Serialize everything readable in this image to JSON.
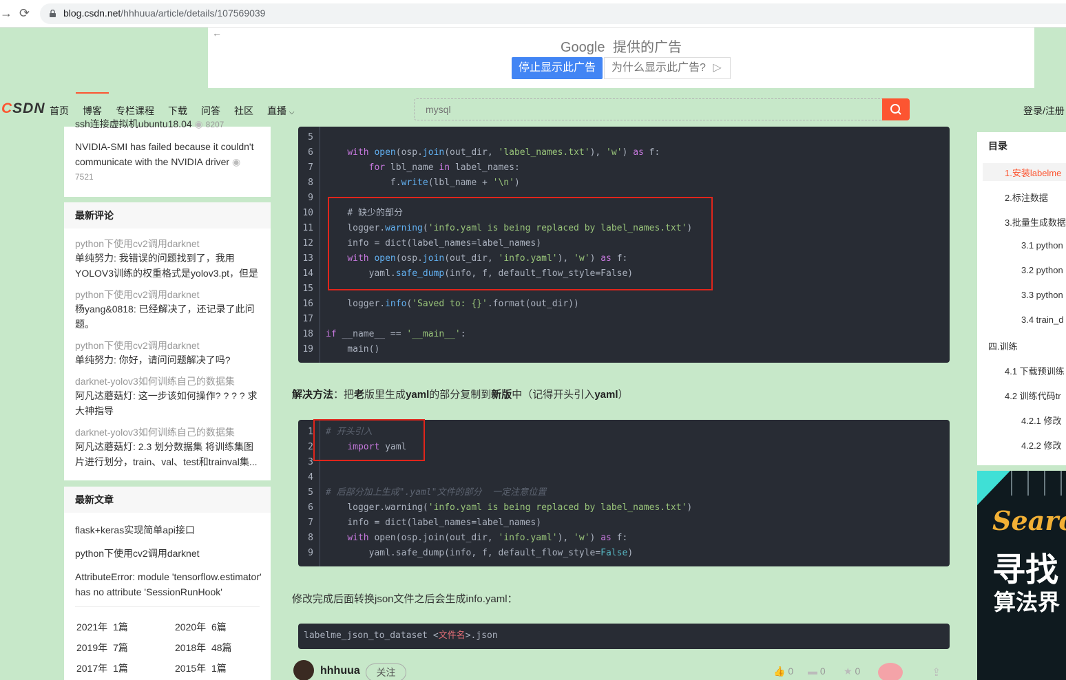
{
  "browser": {
    "url_host": "blog.csdn.net",
    "url_path": "/hhhuua/article/details/107569039"
  },
  "ad": {
    "google_label": "Google",
    "provided_label": "提供的广告",
    "stop_button": "停止显示此广告",
    "why_button": "为什么显示此广告?"
  },
  "toolbar": {
    "logo": "CSDN",
    "nav": [
      "首页",
      "博客",
      "专栏课程",
      "下载",
      "问答",
      "社区",
      "直播"
    ],
    "search_placeholder": "mysql",
    "login": "登录/注册"
  },
  "left": {
    "popular_cut": "ssh连接虚拟机ubuntu18.04",
    "popular_cut_views": "8207",
    "popular_item": "NVIDIA-SMI has failed because it couldn't communicate with the NVIDIA driver",
    "popular_item_views": "7521",
    "comments_title": "最新评论",
    "comments": [
      {
        "article": "python下使用cv2调用darknet",
        "text": "单纯努力: 我错误的问题找到了，我用YOLOV3训练的权重格式是yolov3.pt，但是你..."
      },
      {
        "article": "python下使用cv2调用darknet",
        "text": "杨yang&0818: 已经解决了，还记录了此问题。"
      },
      {
        "article": "python下使用cv2调用darknet",
        "text": "单纯努力: 你好，请问问题解决了吗?"
      },
      {
        "article": "darknet-yolov3如何训练自己的数据集",
        "text": "阿凡达蘑菇灯: 这一步该如何操作? ? ? ? 求大神指导"
      },
      {
        "article": "darknet-yolov3如何训练自己的数据集",
        "text": "阿凡达蘑菇灯: 2.3 划分数据集 将训练集图片进行划分，train、val、test和trainval集..."
      }
    ],
    "articles_title": "最新文章",
    "articles": [
      "flask+keras实现简单api接口",
      "python下使用cv2调用darknet",
      "AttributeError: module 'tensorflow.estimator' has no attribute 'SessionRunHook'"
    ],
    "archive": [
      {
        "year": "2021年",
        "count": "1篇"
      },
      {
        "year": "2020年",
        "count": "6篇"
      },
      {
        "year": "2019年",
        "count": "7篇"
      },
      {
        "year": "2018年",
        "count": "48篇"
      },
      {
        "year": "2017年",
        "count": "1篇"
      },
      {
        "year": "2015年",
        "count": "1篇"
      }
    ]
  },
  "main": {
    "code1_lines": [
      {
        "n": "5",
        "t": ""
      },
      {
        "n": "6",
        "t": "    with open(osp.join(out_dir, 'label_names.txt'), 'w') as f:"
      },
      {
        "n": "7",
        "t": "        for lbl_name in label_names:"
      },
      {
        "n": "8",
        "t": "            f.write(lbl_name + '\\n')"
      },
      {
        "n": "9",
        "t": ""
      },
      {
        "n": "10",
        "t": "    # 缺少的部分"
      },
      {
        "n": "11",
        "t": "    logger.warning('info.yaml is being replaced by label_names.txt')"
      },
      {
        "n": "12",
        "t": "    info = dict(label_names=label_names)"
      },
      {
        "n": "13",
        "t": "    with open(osp.join(out_dir, 'info.yaml'), 'w') as f:"
      },
      {
        "n": "14",
        "t": "        yaml.safe_dump(info, f, default_flow_style=False)"
      },
      {
        "n": "15",
        "t": ""
      },
      {
        "n": "16",
        "t": "    logger.info('Saved to: {}'.format(out_dir))"
      },
      {
        "n": "17",
        "t": ""
      },
      {
        "n": "18",
        "t": "if __name__ == '__main__':"
      },
      {
        "n": "19",
        "t": "    main()"
      }
    ],
    "solution_parts": [
      "解决方法",
      "：把",
      "老",
      "版里生成",
      "yaml",
      "的部分复制到",
      "新版",
      "中（记得开头引入",
      "yaml",
      "）"
    ],
    "code2_lines": [
      {
        "n": "1",
        "t": "# 开头引入"
      },
      {
        "n": "2",
        "t": "    import yaml"
      },
      {
        "n": "3",
        "t": ""
      },
      {
        "n": "4",
        "t": ""
      },
      {
        "n": "5",
        "t": "# 后部分加上生成\".yaml\"文件的部分  一定注意位置"
      },
      {
        "n": "6",
        "t": "    logger.warning('info.yaml is being replaced by label_names.txt')"
      },
      {
        "n": "7",
        "t": "    info = dict(label_names=label_names)"
      },
      {
        "n": "8",
        "t": "    with open(osp.join(out_dir, 'info.yaml'), 'w') as f:"
      },
      {
        "n": "9",
        "t": "        yaml.safe_dump(info, f, default_flow_style=False)"
      }
    ],
    "para2": "修改完成后面转换json文件之后会生成info.yaml：",
    "code3_prefix": "labelme_json_to_dataset <",
    "code3_var": "文件名",
    "code3_suffix": ">.json"
  },
  "toc": {
    "title": "目录",
    "items": [
      "1.安装labelme",
      "2.标注数据",
      "3.批量生成数据",
      "3.1 python",
      "3.2 python",
      "3.3 python",
      "3.4 train_d",
      "四.训练",
      "4.1 下载预训练",
      "4.2 训练代码tr",
      "4.2.1 修改",
      "4.2.2 修改"
    ]
  },
  "right_ad": {
    "line1": "Searc",
    "line2": "寻找",
    "line3": "算法界"
  },
  "bottom": {
    "author": "hhhuua",
    "follow": "关注",
    "likes": "0",
    "comments": "0",
    "favorites": "0"
  },
  "colors": {
    "accent": "#fc5531",
    "background": "#c7e8c9",
    "code_bg": "#282c34",
    "highlight_box": "#e1251b"
  }
}
